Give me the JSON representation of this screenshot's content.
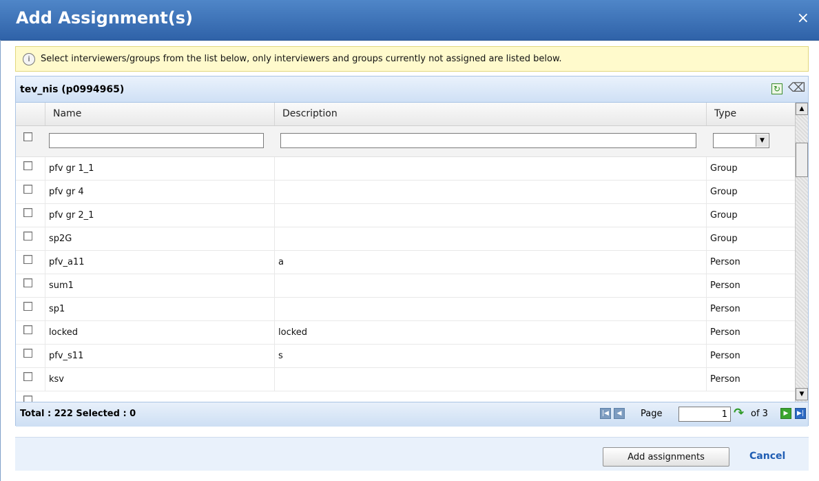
{
  "dialog": {
    "title": "Add Assignment(s)",
    "close_glyph": "×",
    "info_icon": "info-icon",
    "info_text": "Select interviewers/groups from the list below, only interviewers and groups currently not assigned are listed below."
  },
  "panel": {
    "title": "tev_nis (p0994965)",
    "tools": [
      "refresh-icon",
      "eraser-icon"
    ]
  },
  "grid": {
    "columns": {
      "name": "Name",
      "description": "Description",
      "type": "Type"
    },
    "filters": {
      "name": "",
      "description": "",
      "type": ""
    },
    "rows": [
      {
        "name": "pfv gr 1_1",
        "description": "",
        "type": "Group"
      },
      {
        "name": "pfv gr 4",
        "description": "",
        "type": "Group"
      },
      {
        "name": "pfv gr 2_1",
        "description": "",
        "type": "Group"
      },
      {
        "name": "sp2G",
        "description": "",
        "type": "Group"
      },
      {
        "name": "pfv_a11",
        "description": "a",
        "type": "Person"
      },
      {
        "name": "sum1",
        "description": "",
        "type": "Person"
      },
      {
        "name": "sp1",
        "description": "",
        "type": "Person"
      },
      {
        "name": "locked",
        "description": "locked",
        "type": "Person"
      },
      {
        "name": "pfv_s11",
        "description": "s",
        "type": "Person"
      },
      {
        "name": "ksv",
        "description": "",
        "type": "Person"
      }
    ]
  },
  "footer": {
    "total_label": "Total : 222 Selected : 0",
    "page_label": "Page",
    "page_value": "1",
    "of_label": "of 3"
  },
  "actions": {
    "add_label": "Add assignments",
    "cancel_label": "Cancel"
  }
}
